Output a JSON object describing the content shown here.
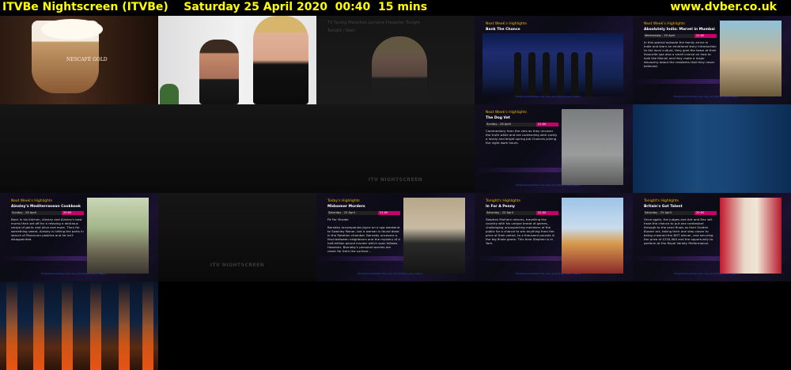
{
  "header": {
    "title": "ITVBe Nightscreen (ITVBe)    Saturday 25 April 2020  00:40  15 mins",
    "site": "www.dvber.co.uk"
  },
  "coffee_tile": {
    "brand": "NESCAFÉ GOLD"
  },
  "news_tile": {
    "ticker": "TV Tuning Marathon Lorraine Presenter Tonight",
    "sub": "Tonight / Next"
  },
  "logos": {
    "itv": "ITV NIGHTSCREEN"
  },
  "cards": [
    {
      "id": "show",
      "head": "Next Week's Highlights",
      "prog": "Bank The Chance",
      "day": "Wednesday - 29 April",
      "time": "21:00",
      "desc": "",
      "foot": "Programme listings may vary according to your region"
    },
    {
      "id": "marie",
      "head": "Next Week's Highlights",
      "prog": "Absolutely India: Marvel in Mumbai",
      "day": "Wednesday - 29 April",
      "time": "21:00",
      "desc": "In this special episode the family arrive in India and learn an emotional story introduction to the local culture, they give the team at their favourite spa also a small course on how to look like Marvel and they make a major discovery about the residents that they never believed.",
      "foot": "Programme listings may vary according to your region"
    },
    {
      "id": "vet",
      "head": "Next Week's Highlights",
      "prog": "The Dog Vet",
      "day": "Sunday - 26 April",
      "time": "21:00",
      "desc": "Commentary from the vets as they uncover the truth while and are contending with surely a lovely and bright spring Job Chances joining the night work hours.",
      "foot": "Programme listings may vary according to your region"
    },
    {
      "id": "ainsley",
      "head": "Next Week's Highlights",
      "prog": "Ainsley's Mediterranean Cookbook",
      "day": "Sunday - 26 April",
      "time": "20:00",
      "desc": "Back in his kitchen, Ainsley and Ainsley's best mums then set off for a relaxing a delicious recipe of garlic and olive and more. Then for something sweet, Ainsley is hitting the parts in search of Moroccan pastries and he isn't disappointed.",
      "foot": "Programme listings may vary according to your region"
    },
    {
      "id": "midsomer",
      "head": "Today's Highlights",
      "prog": "Midsomer Murders",
      "day": "Saturday - 25 April",
      "time": "21:00",
      "desc": "Fit For Murder\n\nBarnaby accompanies Joyce on a spa weekend to Swanley Manor, but a woman is found dead in the flotation chamber. Barnaby uncovers a feud between neighbours and the mystery of a half-million pound murder which soon follows. However, Barnaby's personal worries are never far from the surface...",
      "foot": "Programme listings may vary according to your region"
    },
    {
      "id": "stephen",
      "head": "Tonight's Highlights",
      "prog": "In For A Penny",
      "day": "Saturday - 25 April",
      "time": "21:00",
      "desc": "Stephen Mulhern returns, travelling the country with his unique brand of games, challenging unsuspecting members of the public for a chance to win anything from the price of their petrol, to a thousand pounds in the big finale game. This time Stephen is in York.",
      "foot": "Programme listings may vary according to your region"
    },
    {
      "id": "bgt",
      "head": "Tonight's Highlights",
      "prog": "Britain's Got Talent",
      "day": "Saturday - 25 April",
      "time": "20:00",
      "desc": "Once again, the judges and Ant and Dec will have the chance to put one contestant through to the semi finals as their Golden Buzzer act, taking their one step closer to being crowned the BGT winner, and securing the prize of £250,000 and the opportunity to perform at the Royal Variety Performance.",
      "foot": "Programme listings may vary according to your region"
    }
  ]
}
